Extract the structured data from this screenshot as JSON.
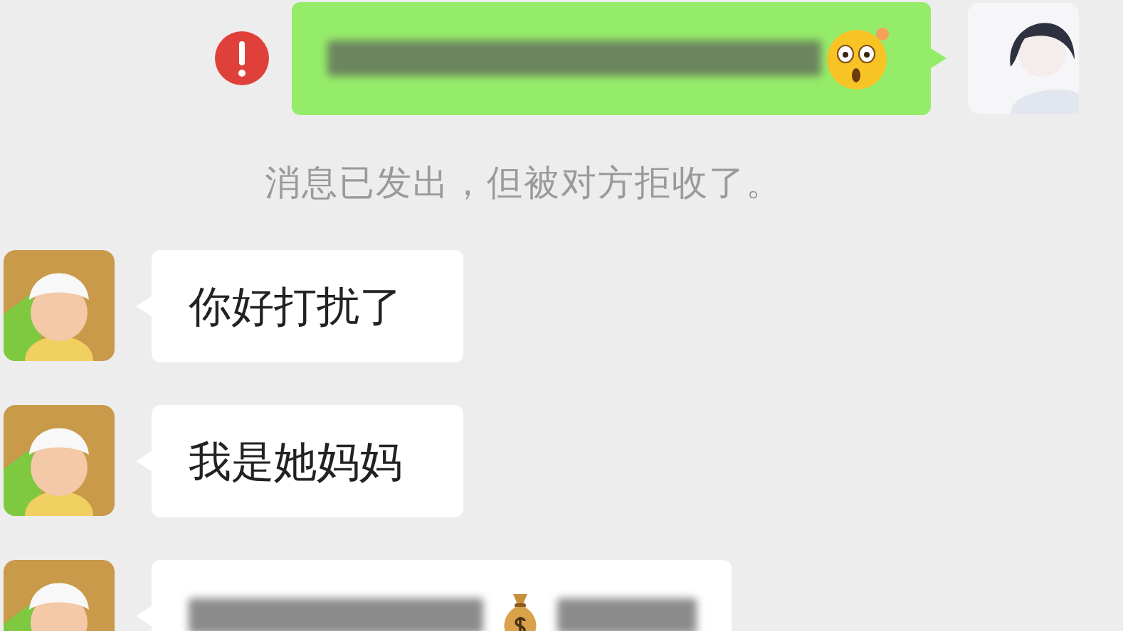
{
  "messages": [
    {
      "kind": "sent",
      "failed": true,
      "obscured": true
    },
    {
      "kind": "notice",
      "text": "消息已发出，但被对方拒收了。"
    },
    {
      "kind": "received",
      "obscured": false,
      "text": "你好打扰了"
    },
    {
      "kind": "received",
      "obscured": false,
      "text": "我是她妈妈"
    },
    {
      "kind": "received",
      "obscured": true
    }
  ]
}
